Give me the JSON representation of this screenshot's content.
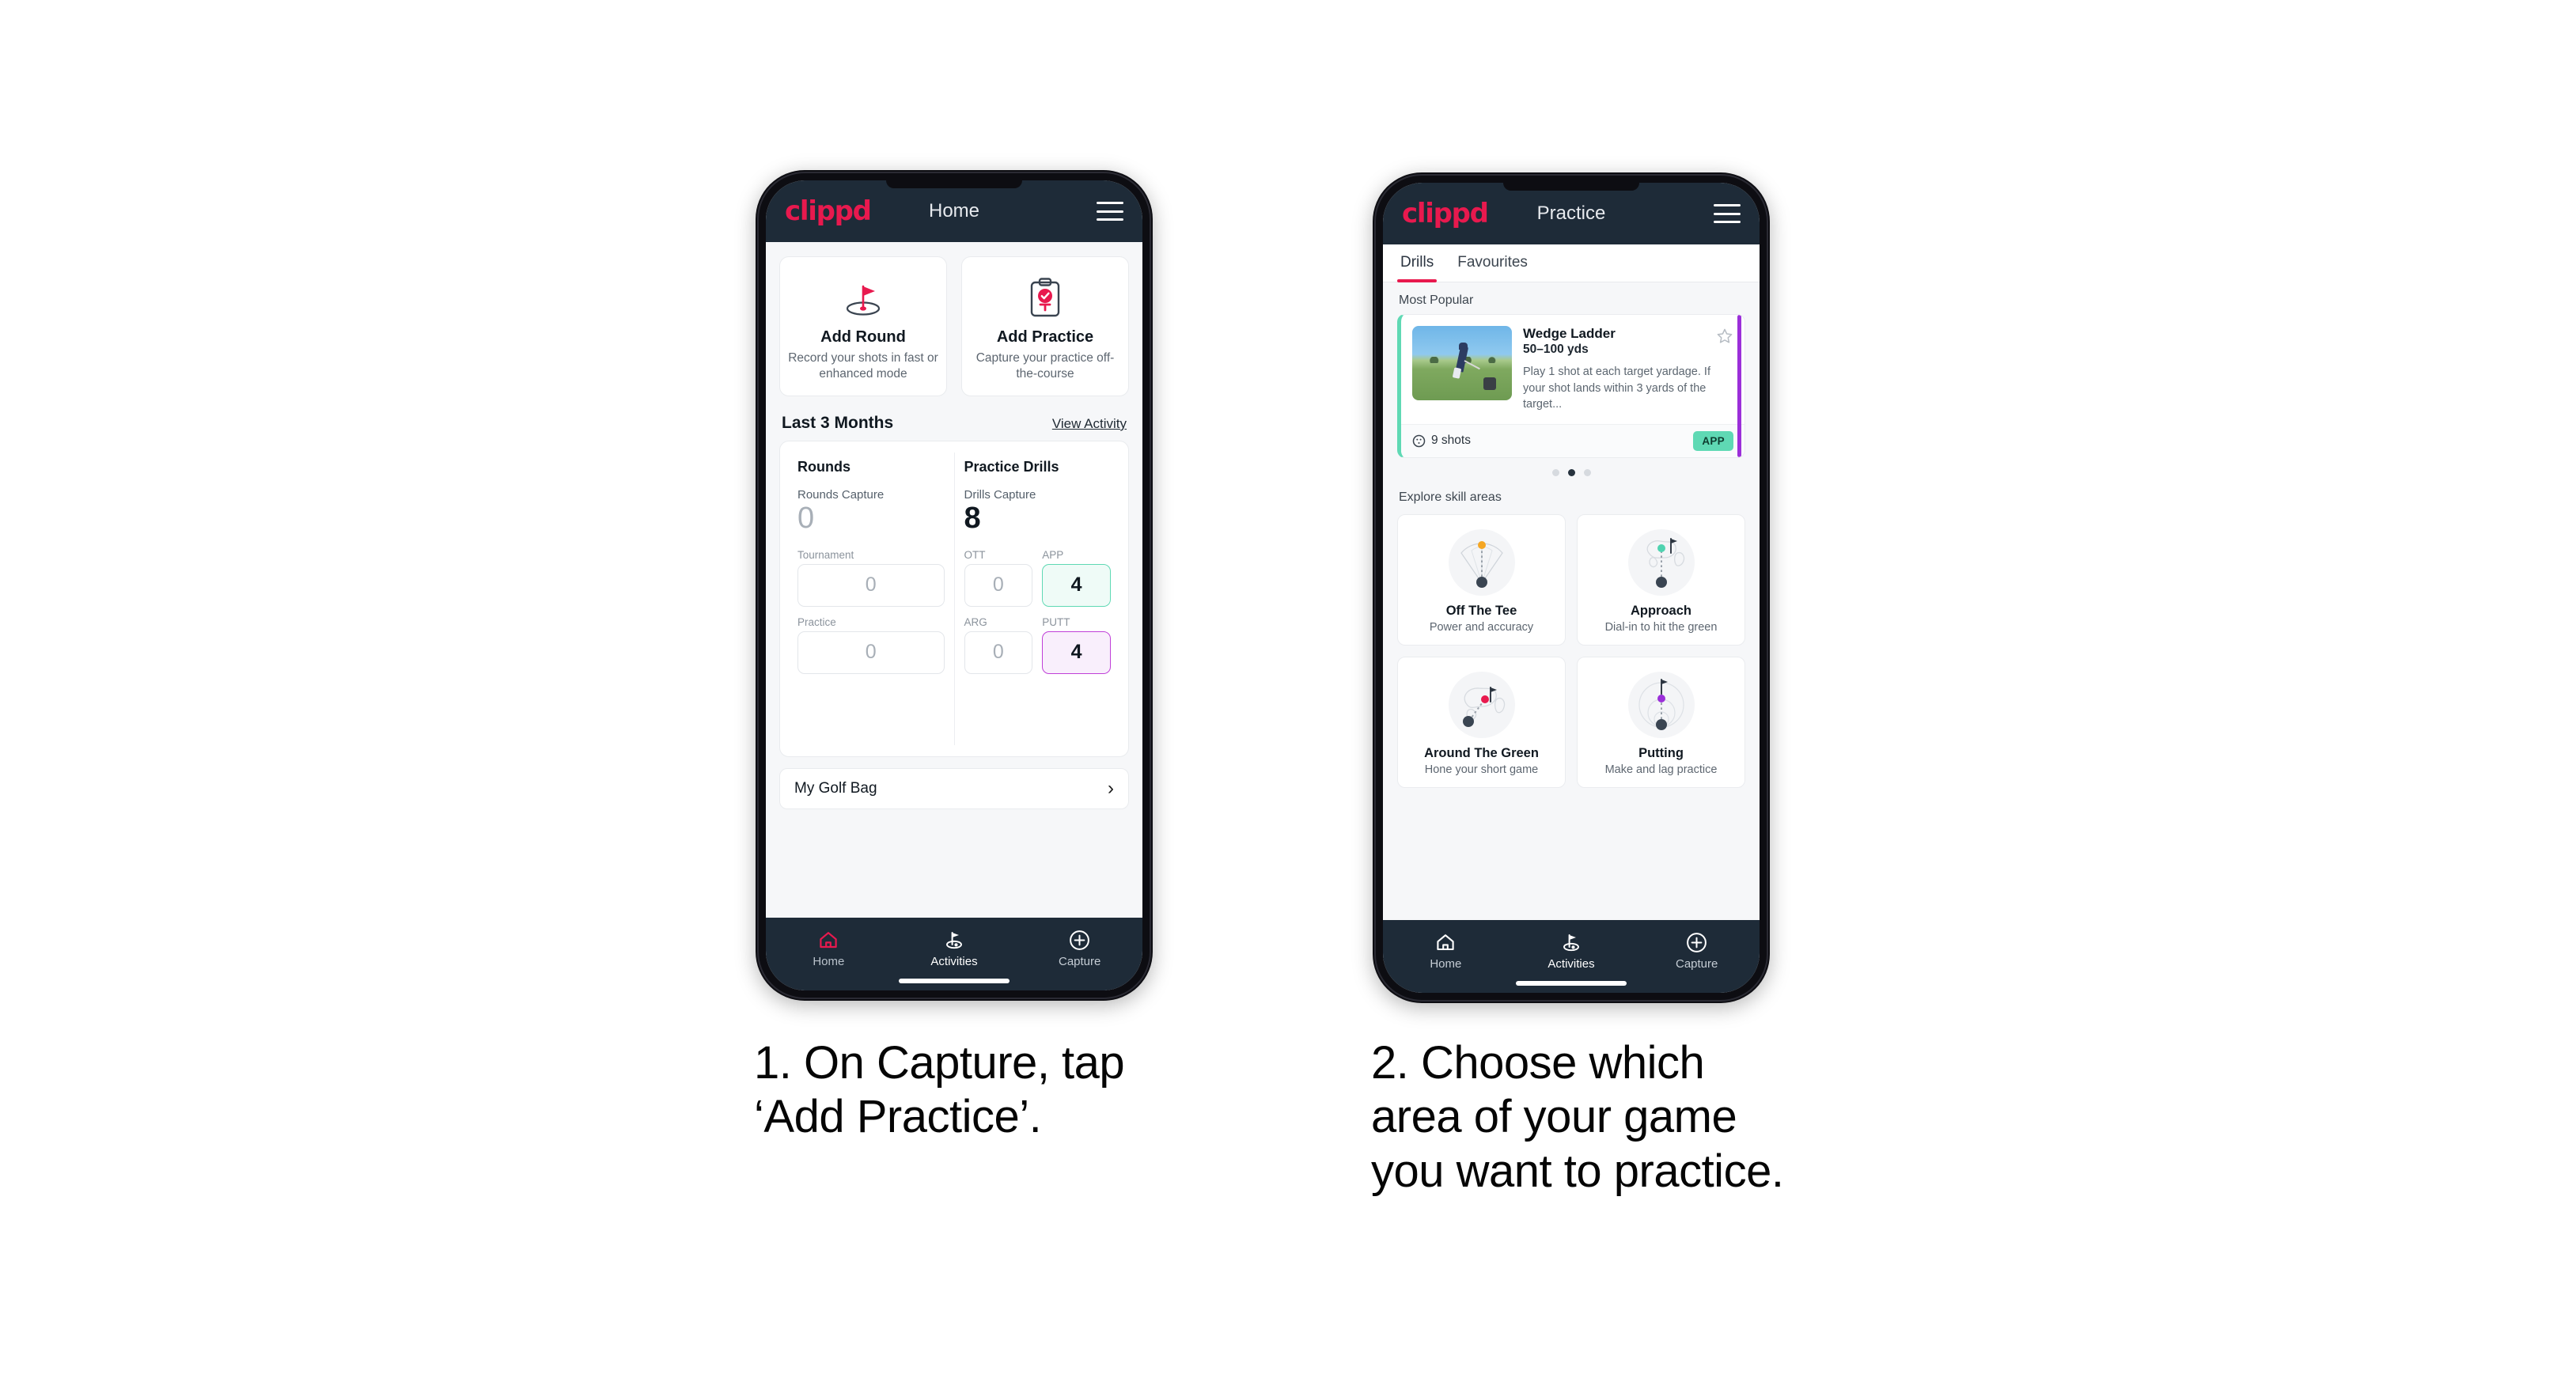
{
  "phone1": {
    "appbar": {
      "logo": "clippd",
      "title": "Home",
      "menu_icon": "hamburger-icon"
    },
    "actions": [
      {
        "icon": "golf-flag-hole-icon",
        "title": "Add Round",
        "subtitle": "Record your shots in fast or enhanced mode"
      },
      {
        "icon": "clipboard-check-tee-icon",
        "title": "Add Practice",
        "subtitle": "Capture your practice off-the-course"
      }
    ],
    "section": {
      "title": "Last 3 Months",
      "link": "View Activity"
    },
    "stats": {
      "rounds": {
        "heading": "Rounds",
        "capture_label": "Rounds Capture",
        "capture_value": "0",
        "items": [
          {
            "label": "Tournament",
            "value": "0",
            "highlight": "none"
          },
          {
            "label": "Practice",
            "value": "0",
            "highlight": "none"
          }
        ]
      },
      "drills": {
        "heading": "Practice Drills",
        "capture_label": "Drills Capture",
        "capture_value": "8",
        "items": [
          {
            "label": "OTT",
            "value": "0",
            "highlight": "none"
          },
          {
            "label": "APP",
            "value": "4",
            "highlight": "app"
          },
          {
            "label": "ARG",
            "value": "0",
            "highlight": "none"
          },
          {
            "label": "PUTT",
            "value": "4",
            "highlight": "putt"
          }
        ]
      }
    },
    "golf_bag": {
      "label": "My Golf Bag",
      "chevron": "chevron-right-icon"
    },
    "nav": [
      {
        "icon": "home-icon",
        "label": "Home",
        "active": false
      },
      {
        "icon": "golf-flag-icon",
        "label": "Activities",
        "active": true
      },
      {
        "icon": "plus-circle-icon",
        "label": "Capture",
        "active": false
      }
    ]
  },
  "phone2": {
    "appbar": {
      "logo": "clippd",
      "title": "Practice",
      "menu_icon": "hamburger-icon"
    },
    "tabs": [
      {
        "label": "Drills",
        "active": true
      },
      {
        "label": "Favourites",
        "active": false
      }
    ],
    "most_popular_label": "Most Popular",
    "drill": {
      "title": "Wedge Ladder",
      "yardage": "50–100 yds",
      "description": "Play 1 shot at each target yardage. If your shot lands within 3 yards of the target...",
      "shots": "9 shots",
      "shots_icon": "clock-icon",
      "badge": "APP",
      "star_icon": "star-outline-icon",
      "accent_color": "#5fd9b4",
      "thumbnail": "golfer-wedge-shot-photo"
    },
    "carousel": {
      "count": 3,
      "active_index": 1
    },
    "explore_label": "Explore skill areas",
    "skills": [
      {
        "icon": "off-the-tee-icon",
        "title": "Off The Tee",
        "subtitle": "Power and accuracy",
        "dot_color": "#f5a623"
      },
      {
        "icon": "approach-icon",
        "title": "Approach",
        "subtitle": "Dial-in to hit the green",
        "dot_color": "#4fd3b0"
      },
      {
        "icon": "around-the-green-icon",
        "title": "Around The Green",
        "subtitle": "Hone your short game",
        "dot_color": "#e8194e"
      },
      {
        "icon": "putting-icon",
        "title": "Putting",
        "subtitle": "Make and lag practice",
        "dot_color": "#9b2fd9"
      }
    ],
    "nav": [
      {
        "icon": "home-icon",
        "label": "Home",
        "active": false
      },
      {
        "icon": "golf-flag-icon",
        "label": "Activities",
        "active": true
      },
      {
        "icon": "plus-circle-icon",
        "label": "Capture",
        "active": false
      }
    ]
  },
  "captions": {
    "step1": "1. On Capture, tap\n‘Add Practice’.",
    "step2": "2. Choose which\narea of your game\nyou want to practice."
  },
  "colors": {
    "brand_pink": "#e8194e",
    "appbar_navy": "#1e2b38",
    "app_green": "#5fd9b4",
    "putt_purple": "#c040d8"
  }
}
